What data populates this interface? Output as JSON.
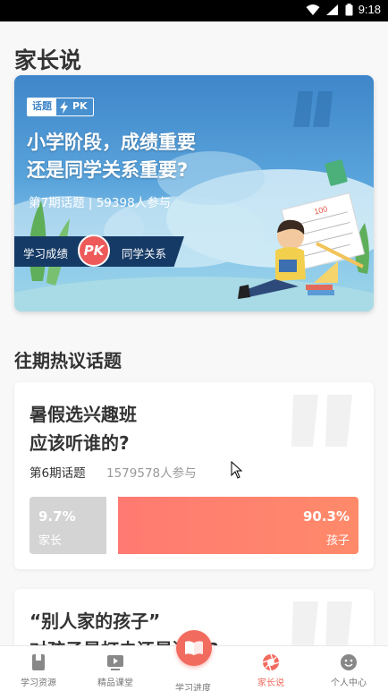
{
  "status_bar": {
    "time": "9:18"
  },
  "page": {
    "title": "家长说"
  },
  "hero": {
    "tag_label": "话题",
    "tag_pk": "PK",
    "title_line1": "小学阶段，成绩重要",
    "title_line2": "还是同学关系重要?",
    "subtitle": "第7期话题 | 59398人参与",
    "side_left": "学习成绩",
    "pk": "PK",
    "side_right": "同学关系",
    "paper_text": "100"
  },
  "section": {
    "title": "往期热议话题"
  },
  "topics": [
    {
      "title_line1": "暑假选兴趣班",
      "title_line2": "应该听谁的?",
      "period": "第6期话题",
      "participants": "1579578人参与",
      "left": {
        "percent": "9.7%",
        "label": "家长"
      },
      "right": {
        "percent": "90.3%",
        "label": "孩子"
      }
    },
    {
      "title_line1": "“别人家的孩子”",
      "title_line2": "对孩子是打击还是激励?"
    }
  ],
  "tabbar": {
    "items": [
      {
        "label": "学习资源",
        "icon": "book-icon"
      },
      {
        "label": "精品课堂",
        "icon": "video-icon"
      },
      {
        "label": "学习进度",
        "icon": "open-book-icon"
      },
      {
        "label": "家长说",
        "icon": "aperture-icon",
        "active": true
      },
      {
        "label": "个人中心",
        "icon": "smiley-icon"
      }
    ]
  },
  "colors": {
    "accent": "#f26b5f",
    "banner_blue": "#3e86c9",
    "vote_gray": "#d4d4d4"
  }
}
